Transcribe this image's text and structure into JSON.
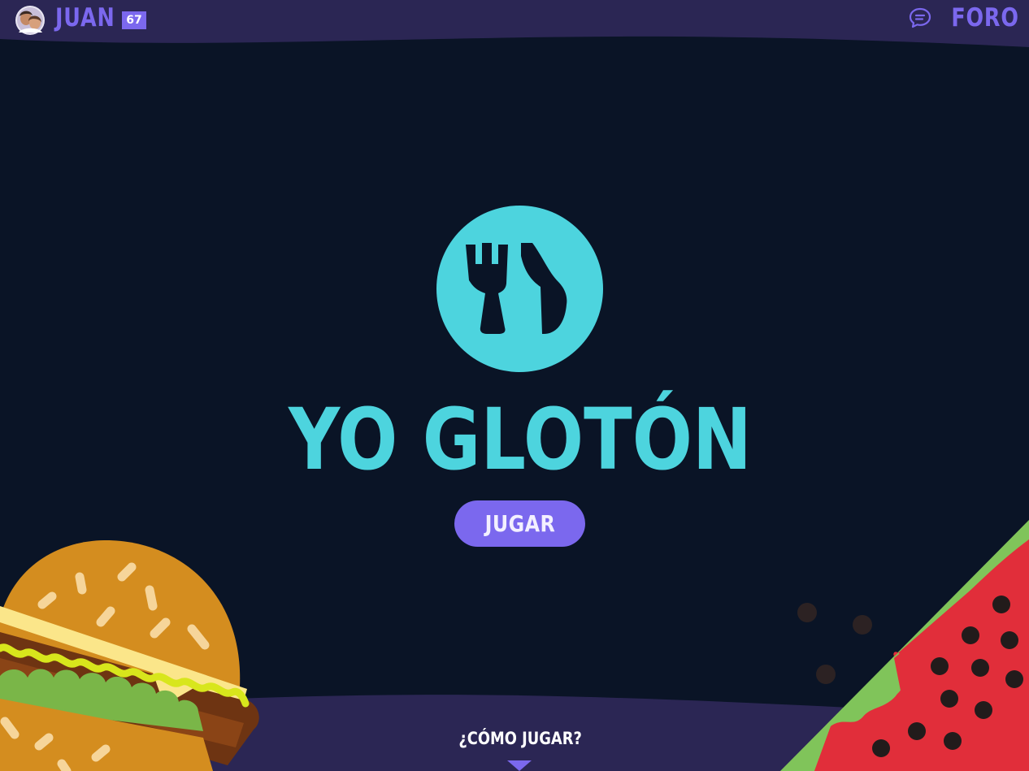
{
  "header": {
    "player_name": "JUAN",
    "level": "67",
    "forum_label": "FORO"
  },
  "icons": {
    "avatar": "avatar",
    "forum": "chat-bubble-icon",
    "logo": "fork-and-knife-icon",
    "arrow": "triangle-down-icon"
  },
  "logo": {
    "title": "YO GLOTÓN"
  },
  "menu": {
    "play_label": "JUGAR",
    "how_to_play_label": "¿CÓMO JUGAR?"
  },
  "colors": {
    "background": "#0a1426",
    "bar": "#2b2654",
    "accent": "#7b68ee",
    "logo": "#4dd4de"
  }
}
